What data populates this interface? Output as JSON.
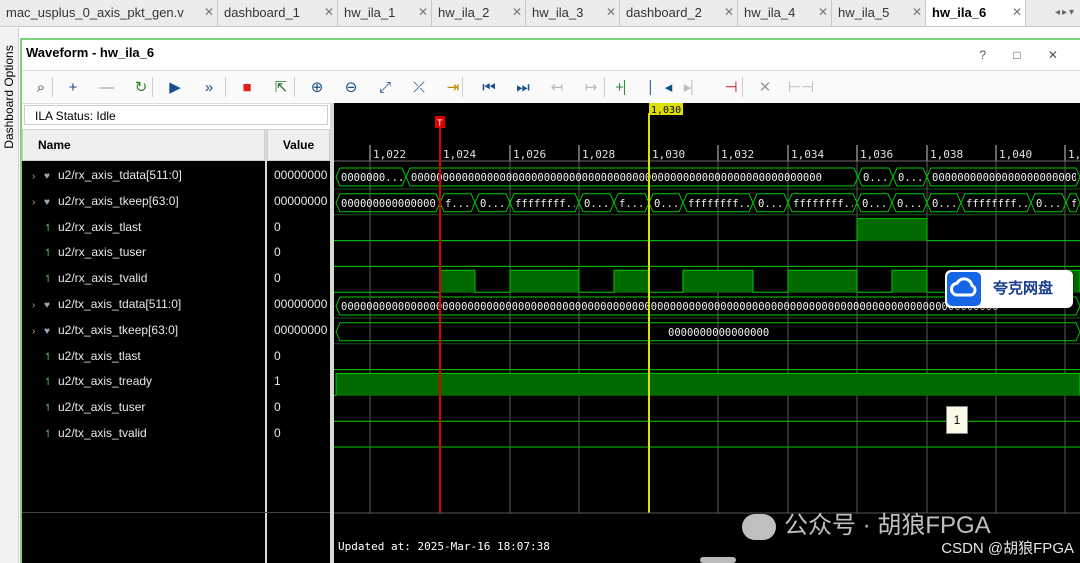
{
  "tabs": [
    {
      "label": "mac_usplus_0_axis_pkt_gen.v",
      "active": false
    },
    {
      "label": "dashboard_1",
      "active": false
    },
    {
      "label": "hw_ila_1",
      "active": false
    },
    {
      "label": "hw_ila_2",
      "active": false
    },
    {
      "label": "hw_ila_3",
      "active": false
    },
    {
      "label": "dashboard_2",
      "active": false
    },
    {
      "label": "hw_ila_4",
      "active": false
    },
    {
      "label": "hw_ila_5",
      "active": false
    },
    {
      "label": "hw_ila_6",
      "active": true
    }
  ],
  "side_label": "Dashboard Options",
  "window": {
    "title": "Waveform - hw_ila_6",
    "controls": "? □ ✕"
  },
  "toolbar": {
    "icons": [
      "search-icon",
      "plus-icon",
      "minus-icon",
      "refresh-icon",
      "run-icon",
      "fast-forward-icon",
      "stop-icon",
      "export-icon",
      "zoom-in-icon",
      "zoom-out-icon",
      "zoom-fit-icon",
      "cursor-to-marker-icon",
      "marker-icon",
      "go-to-start-icon",
      "go-to-end-icon",
      "prev-transition-icon",
      "next-transition-icon",
      "add-marker-icon",
      "prev-marker-icon",
      "next-marker-icon",
      "swap-cursor-icon",
      "delete-marker-icon",
      "snap-icon"
    ]
  },
  "ila_status": "ILA Status:  Idle",
  "columns": {
    "name": "Name",
    "value": "Value"
  },
  "signals": [
    {
      "name": "u2/rx_axis_tdata[511:0]",
      "value": "00000000",
      "bus": true
    },
    {
      "name": "u2/rx_axis_tkeep[63:0]",
      "value": "00000000",
      "bus": true
    },
    {
      "name": "u2/rx_axis_tlast",
      "value": "0",
      "bus": false
    },
    {
      "name": "u2/rx_axis_tuser",
      "value": "0",
      "bus": false
    },
    {
      "name": "u2/rx_axis_tvalid",
      "value": "0",
      "bus": false
    },
    {
      "name": "u2/tx_axis_tdata[511:0]",
      "value": "00000000",
      "bus": true
    },
    {
      "name": "u2/tx_axis_tkeep[63:0]",
      "value": "00000000",
      "bus": true
    },
    {
      "name": "u2/tx_axis_tlast",
      "value": "0",
      "bus": false
    },
    {
      "name": "u2/tx_axis_tready",
      "value": "1",
      "bus": false
    },
    {
      "name": "u2/tx_axis_tuser",
      "value": "0",
      "bus": false
    },
    {
      "name": "u2/tx_axis_tvalid",
      "value": "0",
      "bus": false
    }
  ],
  "timeline": {
    "ticks": [
      "1,022",
      "1,024",
      "1,026",
      "1,028",
      "1,030",
      "1,032",
      "1,034",
      "1,036",
      "1,038",
      "1,040",
      "1,"
    ],
    "cursor_label": "1,030",
    "marker_label": "T"
  },
  "bus_labels": {
    "rx_tdata": [
      "0000000...",
      "00000000000000000000000000000000000000000000000000000000000000000",
      "0...",
      "0...",
      "00000000000000000000000000000000000000000000000000"
    ],
    "rx_tkeep": [
      "0000000000000000",
      "f...",
      "0...",
      "ffffffff...",
      "0...",
      "f...",
      "0...",
      "ffffffff...",
      "0...",
      "ffffffff...",
      "0...",
      "0...",
      "0...",
      "ffffffff...",
      "0...",
      "f..."
    ],
    "tx_tdata": "00000000000000000000000000000000000000000000000000000000000000000000000000000000000000000000000000000000",
    "tx_tkeep": "0000000000000000"
  },
  "overlay": {
    "app_badge": "夸克网盘",
    "tooltip": "1",
    "watermark": "公众号 · 胡狼FPGA",
    "csdn": "CSDN @胡狼FPGA"
  },
  "updated_at": "Updated at: 2025-Mar-16 18:07:38",
  "colors": {
    "wave_bg": "#000000",
    "grid": "#5a5a5a",
    "trace": "#00c800",
    "fill": "#006a00",
    "cursor": "#e0e000",
    "marker": "#e00000",
    "frame": "#7fd07f"
  }
}
